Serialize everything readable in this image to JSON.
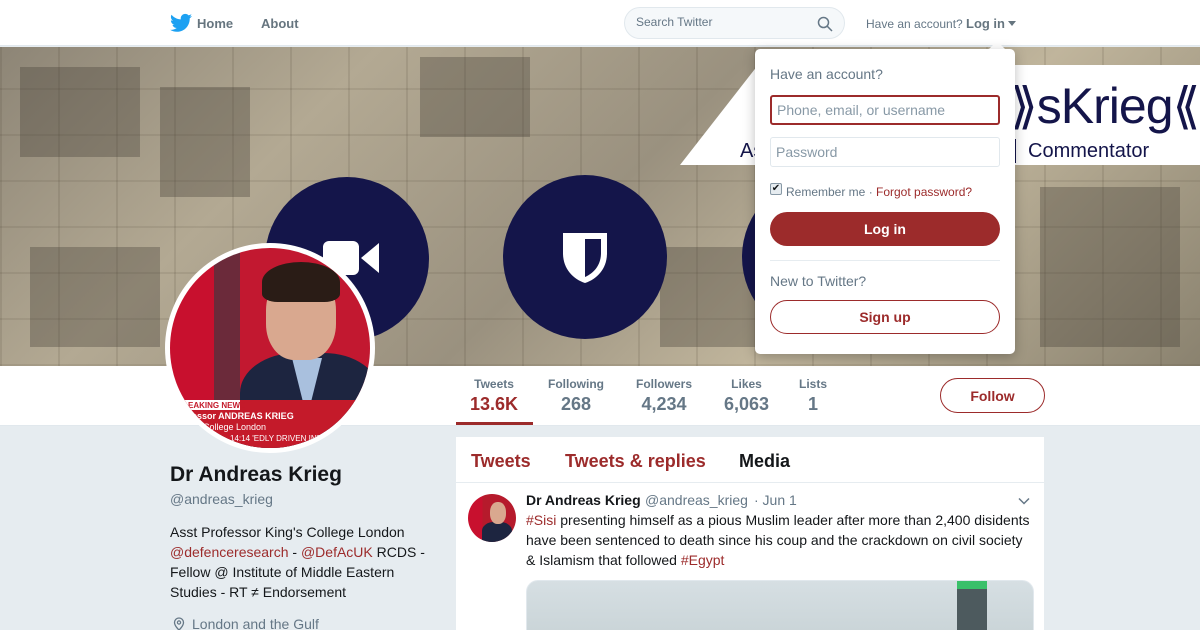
{
  "nav": {
    "logo_icon": "twitter-bird-icon",
    "home_label": "Home",
    "about_label": "About",
    "search_placeholder": "Search Twitter",
    "have_account": "Have an account?",
    "login_label": "Log in"
  },
  "colors": {
    "accent": "#9c2b2b",
    "twitter_blue": "#1da1f2",
    "banner_navy": "#14154a"
  },
  "banner": {
    "logo_text": "⟫sKrieg⟪",
    "subtitle_left": "As",
    "subtitle_right": "Commentator"
  },
  "avatar_overlay": {
    "line1": "EAKING NEWS",
    "line2": "essor ANDREAS KRIEG",
    "line3": "College London",
    "line4": "14:14  'EDLY DRIVEN INT"
  },
  "stats": [
    {
      "label": "Tweets",
      "value": "13.6K"
    },
    {
      "label": "Following",
      "value": "268"
    },
    {
      "label": "Followers",
      "value": "4,234"
    },
    {
      "label": "Likes",
      "value": "6,063"
    },
    {
      "label": "Lists",
      "value": "1"
    }
  ],
  "follow_label": "Follow",
  "profile": {
    "name": "Dr Andreas Krieg",
    "handle": "@andreas_krieg",
    "bio_1": "Asst Professor King's College London",
    "bio_link1": "@defenceresearch",
    "bio_sep": " - ",
    "bio_link2": "@DefAcUK",
    "bio_2": " RCDS - Fellow @ Institute of Middle Eastern Studies - RT ≠ Endorsement",
    "location": "London and the Gulf"
  },
  "timeline": {
    "tabs": [
      "Tweets",
      "Tweets & replies",
      "Media"
    ],
    "tweet": {
      "name": "Dr Andreas Krieg",
      "handle": "@andreas_krieg",
      "time": "· Jun 1",
      "tag1": "#Sisi",
      "text": " presenting himself as a pious Muslim leader after more than 2,400 disidents have been sentenced to death since his coup and the crackdown on civil society & Islamism that followed ",
      "tag2": "#Egypt"
    }
  },
  "login_dropdown": {
    "title": "Have an account?",
    "username_placeholder": "Phone, email, or username",
    "password_placeholder": "Password",
    "remember_label": "Remember me",
    "separator": "·",
    "forgot_label": "Forgot password?",
    "login_button": "Log in",
    "new_label": "New to Twitter?",
    "signup_button": "Sign up"
  }
}
